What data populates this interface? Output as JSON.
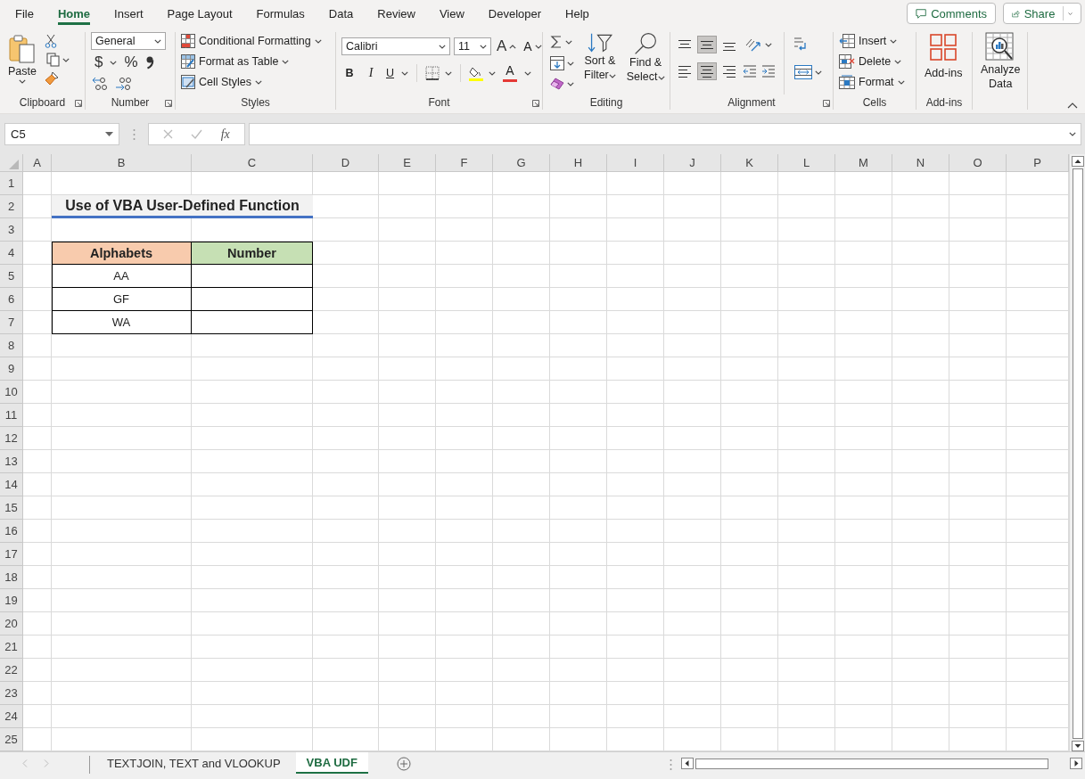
{
  "menu_tabs": [
    {
      "label": "File",
      "selected": false
    },
    {
      "label": "Home",
      "selected": true
    },
    {
      "label": "Insert",
      "selected": false
    },
    {
      "label": "Page Layout",
      "selected": false
    },
    {
      "label": "Formulas",
      "selected": false
    },
    {
      "label": "Data",
      "selected": false
    },
    {
      "label": "Review",
      "selected": false
    },
    {
      "label": "View",
      "selected": false
    },
    {
      "label": "Developer",
      "selected": false
    },
    {
      "label": "Help",
      "selected": false
    }
  ],
  "header_buttons": [
    {
      "label": "Comments",
      "kind": "comments"
    },
    {
      "label": "Share",
      "kind": "share"
    }
  ],
  "ribbon": {
    "clipboard": {
      "label": "Clipboard",
      "paste": "Paste"
    },
    "number": {
      "label": "Number",
      "format": "General",
      "currency": "$",
      "percent": "%"
    },
    "styles": {
      "label": "Styles",
      "commands": [
        "Conditional Formatting",
        "Format as Table",
        "Cell Styles"
      ]
    },
    "font": {
      "label": "Font",
      "family": "Calibri",
      "size": "11",
      "grow": "A",
      "shrink": "A",
      "bold": "B",
      "italic": "I",
      "underline": "U",
      "font_color": "A"
    },
    "editing": {
      "label": "Editing",
      "sort_filter": [
        "Sort &",
        "Filter"
      ],
      "find_select": [
        "Find &",
        "Select"
      ]
    },
    "alignment": {
      "label": "Alignment",
      "vertical": [
        {
          "selected": false
        },
        {
          "selected": true
        },
        {
          "selected": false
        }
      ],
      "horizontal": [
        {
          "selected": false
        },
        {
          "selected": true
        },
        {
          "selected": false
        }
      ]
    },
    "cells": {
      "label": "Cells",
      "commands": [
        "Insert",
        "Delete",
        "Format"
      ]
    },
    "addins": {
      "label": "Add-ins",
      "button": "Add-ins"
    },
    "analyze": {
      "button": [
        "Analyze",
        "Data"
      ]
    }
  },
  "formula_bar": {
    "name_box": "C5",
    "function_label": "fx"
  },
  "sheet": {
    "columns": [
      "A",
      "B",
      "C",
      "D",
      "E",
      "F",
      "G",
      "H",
      "I",
      "J",
      "K",
      "L",
      "M",
      "N",
      "O",
      "P"
    ],
    "rows": [
      "1",
      "2",
      "3",
      "4",
      "5",
      "6",
      "7",
      "8",
      "9",
      "10",
      "11",
      "12",
      "13",
      "14",
      "15",
      "16",
      "17",
      "18",
      "19",
      "20",
      "21",
      "22",
      "23",
      "24",
      "25"
    ],
    "title": "Use of VBA User-Defined Function",
    "table": {
      "columns": [
        {
          "label": "Alphabets",
          "color": "#f8cbad"
        },
        {
          "label": "Number",
          "color": "#c6e0b4"
        }
      ],
      "rows": [
        [
          "AA"
        ],
        [
          "GF"
        ],
        [
          "WA"
        ]
      ]
    }
  },
  "sheet_tabs": [
    {
      "label": "TEXTJOIN, TEXT and VLOOKUP",
      "selected": false
    },
    {
      "label": "VBA UDF",
      "selected": true
    }
  ]
}
